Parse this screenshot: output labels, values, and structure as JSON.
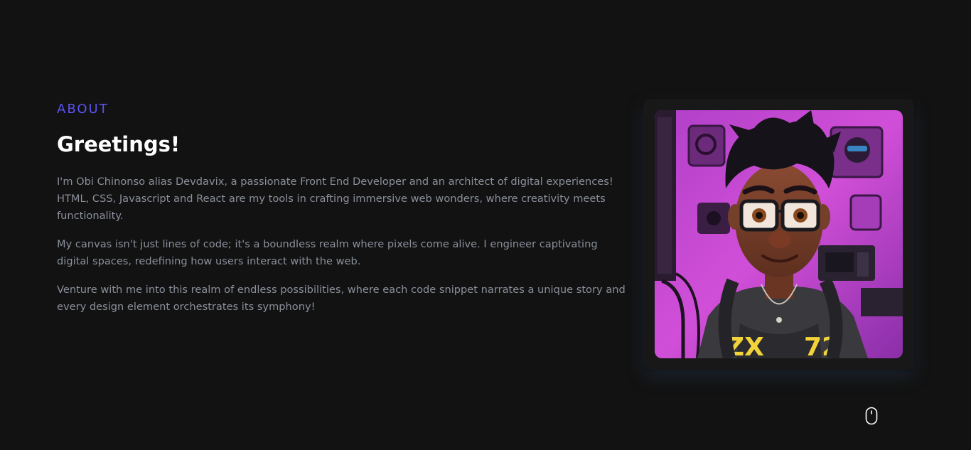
{
  "about": {
    "eyebrow": "ABOUT",
    "title": "Greetings!",
    "paragraphs": [
      "I'm Obi Chinonso alias Devdavix, a passionate Front End Developer and an architect of digital experiences! HTML, CSS, Javascript and React are my tools in crafting immersive web wonders, where creativity meets functionality.",
      "My canvas isn't just lines of code; it's a boundless realm where pixels come alive. I engineer captivating digital spaces, redefining how users interact with the web.",
      "Venture with me into this realm of endless possibilities, where each code snippet narrates a unique story and every design element orchestrates its symphony!"
    ]
  },
  "avatar": {
    "icon": "avatar-illustration",
    "accent_color": "#c04ad6"
  },
  "scroll_indicator": {
    "icon": "mouse-icon"
  },
  "colors": {
    "background": "#121212",
    "accent": "#5b52f0",
    "heading": "#ffffff",
    "body_text": "#8a8f9a"
  }
}
